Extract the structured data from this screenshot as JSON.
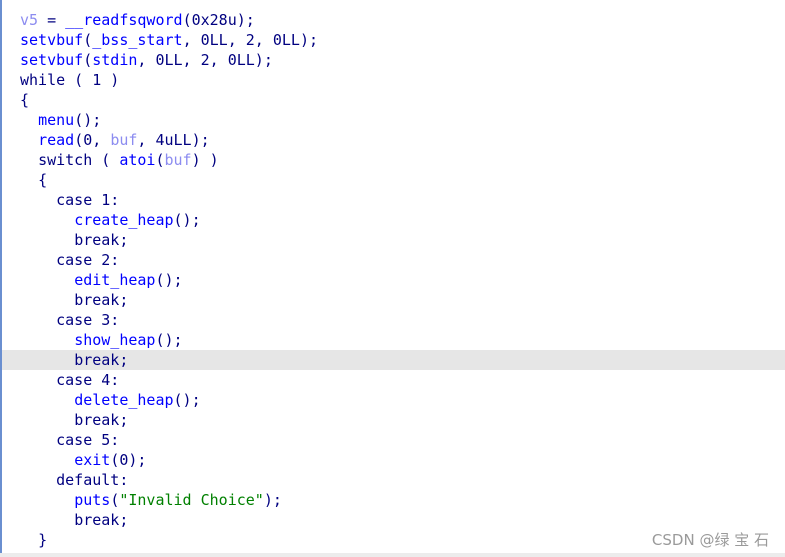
{
  "colors": {
    "keyword": "#000080",
    "function": "#0000ff",
    "variable": "#8c8cf0",
    "string": "#008000",
    "highlight": "#e6e6e6"
  },
  "highlighted_line": 17,
  "lines": [
    {
      "indent": 0,
      "tokens": [
        [
          "v5",
          "var"
        ],
        [
          " = ",
          "p"
        ],
        [
          "__readfsqword",
          "fn"
        ],
        [
          "(0x28u);",
          "p"
        ]
      ]
    },
    {
      "indent": 0,
      "tokens": [
        [
          "setvbuf",
          "fn"
        ],
        [
          "(",
          "p"
        ],
        [
          "_bss_start",
          "fn"
        ],
        [
          ", 0LL, 2, 0LL);",
          "p"
        ]
      ]
    },
    {
      "indent": 0,
      "tokens": [
        [
          "setvbuf",
          "fn"
        ],
        [
          "(",
          "p"
        ],
        [
          "stdin",
          "fn"
        ],
        [
          ", 0LL, 2, 0LL);",
          "p"
        ]
      ]
    },
    {
      "indent": 0,
      "tokens": [
        [
          "while ( 1 )",
          "kw"
        ]
      ]
    },
    {
      "indent": 0,
      "tokens": [
        [
          "{",
          "p"
        ]
      ]
    },
    {
      "indent": 1,
      "tokens": [
        [
          "menu",
          "fn"
        ],
        [
          "();",
          "p"
        ]
      ]
    },
    {
      "indent": 1,
      "tokens": [
        [
          "read",
          "fn"
        ],
        [
          "(0, ",
          "p"
        ],
        [
          "buf",
          "var"
        ],
        [
          ", 4uLL);",
          "p"
        ]
      ]
    },
    {
      "indent": 1,
      "tokens": [
        [
          "switch ( ",
          "kw"
        ],
        [
          "atoi",
          "fn"
        ],
        [
          "(",
          "p"
        ],
        [
          "buf",
          "var"
        ],
        [
          ") )",
          "p"
        ]
      ]
    },
    {
      "indent": 1,
      "tokens": [
        [
          "{",
          "p"
        ]
      ]
    },
    {
      "indent": 2,
      "tokens": [
        [
          "case 1:",
          "kw"
        ]
      ]
    },
    {
      "indent": 3,
      "tokens": [
        [
          "create_heap",
          "fn"
        ],
        [
          "();",
          "p"
        ]
      ]
    },
    {
      "indent": 3,
      "tokens": [
        [
          "break;",
          "kw"
        ]
      ]
    },
    {
      "indent": 2,
      "tokens": [
        [
          "case 2:",
          "kw"
        ]
      ]
    },
    {
      "indent": 3,
      "tokens": [
        [
          "edit_heap",
          "fn"
        ],
        [
          "();",
          "p"
        ]
      ]
    },
    {
      "indent": 3,
      "tokens": [
        [
          "break;",
          "kw"
        ]
      ]
    },
    {
      "indent": 2,
      "tokens": [
        [
          "case 3:",
          "kw"
        ]
      ]
    },
    {
      "indent": 3,
      "tokens": [
        [
          "show_heap",
          "fn"
        ],
        [
          "();",
          "p"
        ]
      ]
    },
    {
      "indent": 3,
      "tokens": [
        [
          "break;",
          "kw"
        ]
      ]
    },
    {
      "indent": 2,
      "tokens": [
        [
          "case 4:",
          "kw"
        ]
      ]
    },
    {
      "indent": 3,
      "tokens": [
        [
          "delete_heap",
          "fn"
        ],
        [
          "();",
          "p"
        ]
      ]
    },
    {
      "indent": 3,
      "tokens": [
        [
          "break;",
          "kw"
        ]
      ]
    },
    {
      "indent": 2,
      "tokens": [
        [
          "case 5:",
          "kw"
        ]
      ]
    },
    {
      "indent": 3,
      "tokens": [
        [
          "exit",
          "fn"
        ],
        [
          "(0);",
          "p"
        ]
      ]
    },
    {
      "indent": 2,
      "tokens": [
        [
          "default:",
          "kw"
        ]
      ]
    },
    {
      "indent": 3,
      "tokens": [
        [
          "puts",
          "fn"
        ],
        [
          "(",
          "p"
        ],
        [
          "\"Invalid Choice\"",
          "str"
        ],
        [
          ");",
          "p"
        ]
      ]
    },
    {
      "indent": 3,
      "tokens": [
        [
          "break;",
          "kw"
        ]
      ]
    },
    {
      "indent": 1,
      "tokens": [
        [
          "}",
          "p"
        ]
      ]
    }
  ],
  "watermark": "CSDN @绿 宝 石"
}
